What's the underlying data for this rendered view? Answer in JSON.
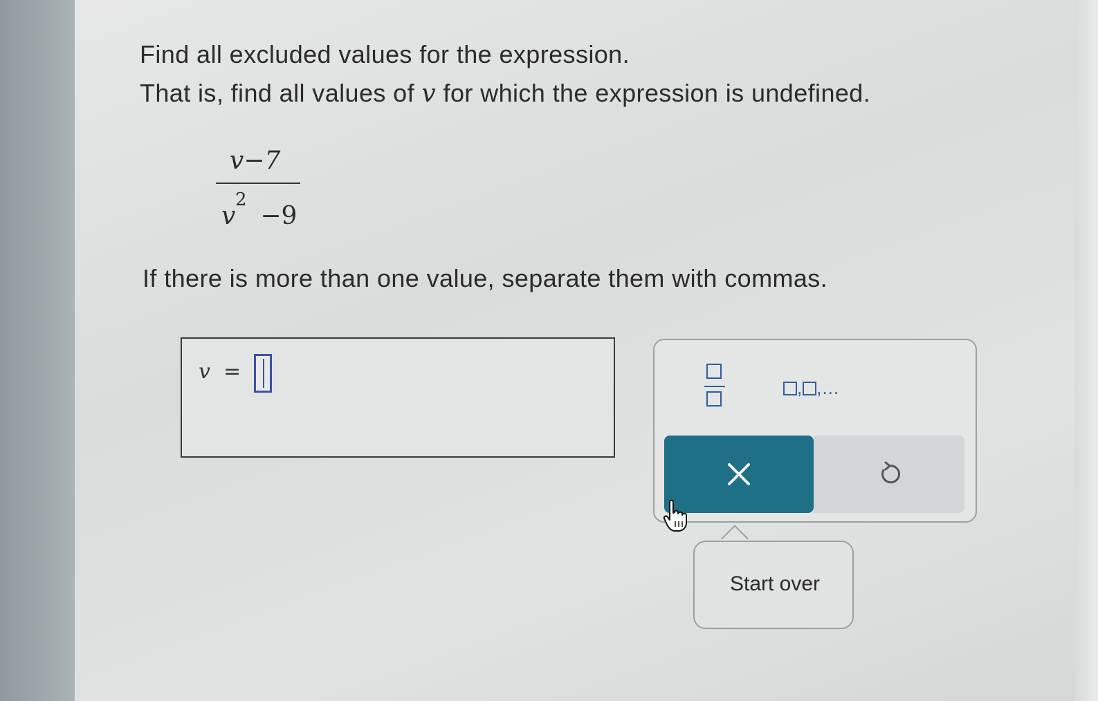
{
  "question": {
    "line1": "Find all excluded values for the expression.",
    "line2_prefix": "That is, find all values of ",
    "line2_var": "v",
    "line2_suffix": " for which the expression is undefined.",
    "expression": {
      "numerator": "v−7",
      "denominator_base": "v",
      "denominator_exponent": "2",
      "denominator_rest": "−9"
    },
    "instruction": "If there is more than one value, separate them with commas."
  },
  "answer": {
    "variable": "v",
    "equals": "=",
    "value": ""
  },
  "toolbar": {
    "list_label_suffix": ",...",
    "clear_symbol": "×",
    "undo_symbol": "↺",
    "tooltip": "Start over"
  },
  "colors": {
    "accent": "#1f6f86",
    "input_border": "#3b52a3",
    "tool_icon": "#2f5d9e"
  }
}
